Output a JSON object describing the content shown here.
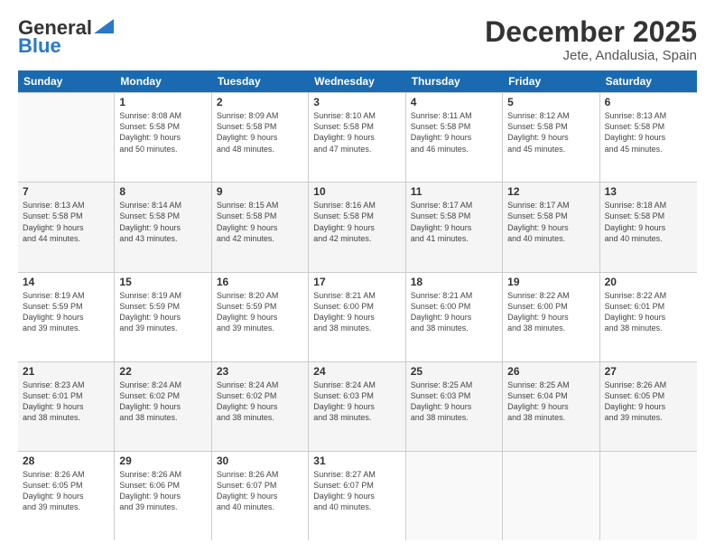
{
  "logo": {
    "general": "General",
    "blue": "Blue"
  },
  "title": "December 2025",
  "location": "Jete, Andalusia, Spain",
  "days_of_week": [
    "Sunday",
    "Monday",
    "Tuesday",
    "Wednesday",
    "Thursday",
    "Friday",
    "Saturday"
  ],
  "weeks": [
    [
      {
        "day": "",
        "empty": true
      },
      {
        "day": "1",
        "lines": [
          "Sunrise: 8:08 AM",
          "Sunset: 5:58 PM",
          "Daylight: 9 hours",
          "and 50 minutes."
        ]
      },
      {
        "day": "2",
        "lines": [
          "Sunrise: 8:09 AM",
          "Sunset: 5:58 PM",
          "Daylight: 9 hours",
          "and 48 minutes."
        ]
      },
      {
        "day": "3",
        "lines": [
          "Sunrise: 8:10 AM",
          "Sunset: 5:58 PM",
          "Daylight: 9 hours",
          "and 47 minutes."
        ]
      },
      {
        "day": "4",
        "lines": [
          "Sunrise: 8:11 AM",
          "Sunset: 5:58 PM",
          "Daylight: 9 hours",
          "and 46 minutes."
        ]
      },
      {
        "day": "5",
        "lines": [
          "Sunrise: 8:12 AM",
          "Sunset: 5:58 PM",
          "Daylight: 9 hours",
          "and 45 minutes."
        ]
      },
      {
        "day": "6",
        "lines": [
          "Sunrise: 8:13 AM",
          "Sunset: 5:58 PM",
          "Daylight: 9 hours",
          "and 45 minutes."
        ]
      }
    ],
    [
      {
        "day": "7",
        "lines": [
          "Sunrise: 8:13 AM",
          "Sunset: 5:58 PM",
          "Daylight: 9 hours",
          "and 44 minutes."
        ]
      },
      {
        "day": "8",
        "lines": [
          "Sunrise: 8:14 AM",
          "Sunset: 5:58 PM",
          "Daylight: 9 hours",
          "and 43 minutes."
        ]
      },
      {
        "day": "9",
        "lines": [
          "Sunrise: 8:15 AM",
          "Sunset: 5:58 PM",
          "Daylight: 9 hours",
          "and 42 minutes."
        ]
      },
      {
        "day": "10",
        "lines": [
          "Sunrise: 8:16 AM",
          "Sunset: 5:58 PM",
          "Daylight: 9 hours",
          "and 42 minutes."
        ]
      },
      {
        "day": "11",
        "lines": [
          "Sunrise: 8:17 AM",
          "Sunset: 5:58 PM",
          "Daylight: 9 hours",
          "and 41 minutes."
        ]
      },
      {
        "day": "12",
        "lines": [
          "Sunrise: 8:17 AM",
          "Sunset: 5:58 PM",
          "Daylight: 9 hours",
          "and 40 minutes."
        ]
      },
      {
        "day": "13",
        "lines": [
          "Sunrise: 8:18 AM",
          "Sunset: 5:58 PM",
          "Daylight: 9 hours",
          "and 40 minutes."
        ]
      }
    ],
    [
      {
        "day": "14",
        "lines": [
          "Sunrise: 8:19 AM",
          "Sunset: 5:59 PM",
          "Daylight: 9 hours",
          "and 39 minutes."
        ]
      },
      {
        "day": "15",
        "lines": [
          "Sunrise: 8:19 AM",
          "Sunset: 5:59 PM",
          "Daylight: 9 hours",
          "and 39 minutes."
        ]
      },
      {
        "day": "16",
        "lines": [
          "Sunrise: 8:20 AM",
          "Sunset: 5:59 PM",
          "Daylight: 9 hours",
          "and 39 minutes."
        ]
      },
      {
        "day": "17",
        "lines": [
          "Sunrise: 8:21 AM",
          "Sunset: 6:00 PM",
          "Daylight: 9 hours",
          "and 38 minutes."
        ]
      },
      {
        "day": "18",
        "lines": [
          "Sunrise: 8:21 AM",
          "Sunset: 6:00 PM",
          "Daylight: 9 hours",
          "and 38 minutes."
        ]
      },
      {
        "day": "19",
        "lines": [
          "Sunrise: 8:22 AM",
          "Sunset: 6:00 PM",
          "Daylight: 9 hours",
          "and 38 minutes."
        ]
      },
      {
        "day": "20",
        "lines": [
          "Sunrise: 8:22 AM",
          "Sunset: 6:01 PM",
          "Daylight: 9 hours",
          "and 38 minutes."
        ]
      }
    ],
    [
      {
        "day": "21",
        "lines": [
          "Sunrise: 8:23 AM",
          "Sunset: 6:01 PM",
          "Daylight: 9 hours",
          "and 38 minutes."
        ]
      },
      {
        "day": "22",
        "lines": [
          "Sunrise: 8:24 AM",
          "Sunset: 6:02 PM",
          "Daylight: 9 hours",
          "and 38 minutes."
        ]
      },
      {
        "day": "23",
        "lines": [
          "Sunrise: 8:24 AM",
          "Sunset: 6:02 PM",
          "Daylight: 9 hours",
          "and 38 minutes."
        ]
      },
      {
        "day": "24",
        "lines": [
          "Sunrise: 8:24 AM",
          "Sunset: 6:03 PM",
          "Daylight: 9 hours",
          "and 38 minutes."
        ]
      },
      {
        "day": "25",
        "lines": [
          "Sunrise: 8:25 AM",
          "Sunset: 6:03 PM",
          "Daylight: 9 hours",
          "and 38 minutes."
        ]
      },
      {
        "day": "26",
        "lines": [
          "Sunrise: 8:25 AM",
          "Sunset: 6:04 PM",
          "Daylight: 9 hours",
          "and 38 minutes."
        ]
      },
      {
        "day": "27",
        "lines": [
          "Sunrise: 8:26 AM",
          "Sunset: 6:05 PM",
          "Daylight: 9 hours",
          "and 39 minutes."
        ]
      }
    ],
    [
      {
        "day": "28",
        "lines": [
          "Sunrise: 8:26 AM",
          "Sunset: 6:05 PM",
          "Daylight: 9 hours",
          "and 39 minutes."
        ]
      },
      {
        "day": "29",
        "lines": [
          "Sunrise: 8:26 AM",
          "Sunset: 6:06 PM",
          "Daylight: 9 hours",
          "and 39 minutes."
        ]
      },
      {
        "day": "30",
        "lines": [
          "Sunrise: 8:26 AM",
          "Sunset: 6:07 PM",
          "Daylight: 9 hours",
          "and 40 minutes."
        ]
      },
      {
        "day": "31",
        "lines": [
          "Sunrise: 8:27 AM",
          "Sunset: 6:07 PM",
          "Daylight: 9 hours",
          "and 40 minutes."
        ]
      },
      {
        "day": "",
        "empty": true
      },
      {
        "day": "",
        "empty": true
      },
      {
        "day": "",
        "empty": true
      }
    ]
  ]
}
